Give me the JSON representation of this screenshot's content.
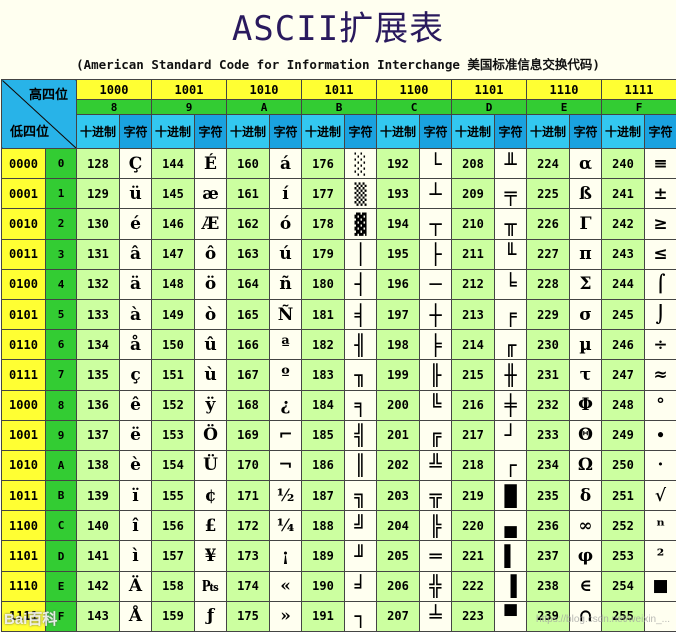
{
  "title": "ASCII扩展表",
  "subtitle": "(American Standard Code for Information Interchange  美国标准信息交换代码)",
  "corner": {
    "high_label": "高四位",
    "low_label": "低四位"
  },
  "sub_labels": {
    "decimal": "十进制",
    "char": "字符"
  },
  "columns": [
    {
      "bin": "1000",
      "hex": "8"
    },
    {
      "bin": "1001",
      "hex": "9"
    },
    {
      "bin": "1010",
      "hex": "A"
    },
    {
      "bin": "1011",
      "hex": "B"
    },
    {
      "bin": "1100",
      "hex": "C"
    },
    {
      "bin": "1101",
      "hex": "D"
    },
    {
      "bin": "1110",
      "hex": "E"
    },
    {
      "bin": "1111",
      "hex": "F"
    }
  ],
  "rows": [
    {
      "bin": "0000",
      "hex": "0",
      "cells": [
        [
          "128",
          "Ç"
        ],
        [
          "144",
          "É"
        ],
        [
          "160",
          "á"
        ],
        [
          "176",
          "░"
        ],
        [
          "192",
          "└"
        ],
        [
          "208",
          "╨"
        ],
        [
          "224",
          "α"
        ],
        [
          "240",
          "≡"
        ]
      ]
    },
    {
      "bin": "0001",
      "hex": "1",
      "cells": [
        [
          "129",
          "ü"
        ],
        [
          "145",
          "æ"
        ],
        [
          "161",
          "í"
        ],
        [
          "177",
          "▒"
        ],
        [
          "193",
          "┴"
        ],
        [
          "209",
          "╤"
        ],
        [
          "225",
          "ß"
        ],
        [
          "241",
          "±"
        ]
      ]
    },
    {
      "bin": "0010",
      "hex": "2",
      "cells": [
        [
          "130",
          "é"
        ],
        [
          "146",
          "Æ"
        ],
        [
          "162",
          "ó"
        ],
        [
          "178",
          "▓"
        ],
        [
          "194",
          "┬"
        ],
        [
          "210",
          "╥"
        ],
        [
          "226",
          "Γ"
        ],
        [
          "242",
          "≥"
        ]
      ]
    },
    {
      "bin": "0011",
      "hex": "3",
      "cells": [
        [
          "131",
          "â"
        ],
        [
          "147",
          "ô"
        ],
        [
          "163",
          "ú"
        ],
        [
          "179",
          "│"
        ],
        [
          "195",
          "├"
        ],
        [
          "211",
          "╙"
        ],
        [
          "227",
          "π"
        ],
        [
          "243",
          "≤"
        ]
      ]
    },
    {
      "bin": "0100",
      "hex": "4",
      "cells": [
        [
          "132",
          "ä"
        ],
        [
          "148",
          "ö"
        ],
        [
          "164",
          "ñ"
        ],
        [
          "180",
          "┤"
        ],
        [
          "196",
          "─"
        ],
        [
          "212",
          "╘"
        ],
        [
          "228",
          "Σ"
        ],
        [
          "244",
          "⌠"
        ]
      ]
    },
    {
      "bin": "0101",
      "hex": "5",
      "cells": [
        [
          "133",
          "à"
        ],
        [
          "149",
          "ò"
        ],
        [
          "165",
          "Ñ"
        ],
        [
          "181",
          "╡"
        ],
        [
          "197",
          "┼"
        ],
        [
          "213",
          "╒"
        ],
        [
          "229",
          "σ"
        ],
        [
          "245",
          "⌡"
        ]
      ]
    },
    {
      "bin": "0110",
      "hex": "6",
      "cells": [
        [
          "134",
          "å"
        ],
        [
          "150",
          "û"
        ],
        [
          "166",
          "ª"
        ],
        [
          "182",
          "╢"
        ],
        [
          "198",
          "╞"
        ],
        [
          "214",
          "╓"
        ],
        [
          "230",
          "µ"
        ],
        [
          "246",
          "÷"
        ]
      ]
    },
    {
      "bin": "0111",
      "hex": "7",
      "cells": [
        [
          "135",
          "ç"
        ],
        [
          "151",
          "ù"
        ],
        [
          "167",
          "º"
        ],
        [
          "183",
          "╖"
        ],
        [
          "199",
          "╟"
        ],
        [
          "215",
          "╫"
        ],
        [
          "231",
          "τ"
        ],
        [
          "247",
          "≈"
        ]
      ]
    },
    {
      "bin": "1000",
      "hex": "8",
      "cells": [
        [
          "136",
          "ê"
        ],
        [
          "152",
          "ÿ"
        ],
        [
          "168",
          "¿"
        ],
        [
          "184",
          "╕"
        ],
        [
          "200",
          "╚"
        ],
        [
          "216",
          "╪"
        ],
        [
          "232",
          "Φ"
        ],
        [
          "248",
          "°"
        ]
      ]
    },
    {
      "bin": "1001",
      "hex": "9",
      "cells": [
        [
          "137",
          "ë"
        ],
        [
          "153",
          "Ö"
        ],
        [
          "169",
          "⌐"
        ],
        [
          "185",
          "╣"
        ],
        [
          "201",
          "╔"
        ],
        [
          "217",
          "┘"
        ],
        [
          "233",
          "Θ"
        ],
        [
          "249",
          "∙"
        ]
      ]
    },
    {
      "bin": "1010",
      "hex": "A",
      "cells": [
        [
          "138",
          "è"
        ],
        [
          "154",
          "Ü"
        ],
        [
          "170",
          "¬"
        ],
        [
          "186",
          "║"
        ],
        [
          "202",
          "╩"
        ],
        [
          "218",
          "┌"
        ],
        [
          "234",
          "Ω"
        ],
        [
          "250",
          "·"
        ]
      ]
    },
    {
      "bin": "1011",
      "hex": "B",
      "cells": [
        [
          "139",
          "ï"
        ],
        [
          "155",
          "¢"
        ],
        [
          "171",
          "½"
        ],
        [
          "187",
          "╗"
        ],
        [
          "203",
          "╦"
        ],
        [
          "219",
          "█"
        ],
        [
          "235",
          "δ"
        ],
        [
          "251",
          "√"
        ]
      ]
    },
    {
      "bin": "1100",
      "hex": "C",
      "cells": [
        [
          "140",
          "î"
        ],
        [
          "156",
          "£"
        ],
        [
          "172",
          "¼"
        ],
        [
          "188",
          "╝"
        ],
        [
          "204",
          "╠"
        ],
        [
          "220",
          "▄"
        ],
        [
          "236",
          "∞"
        ],
        [
          "252",
          "ⁿ"
        ]
      ]
    },
    {
      "bin": "1101",
      "hex": "D",
      "cells": [
        [
          "141",
          "ì"
        ],
        [
          "157",
          "¥"
        ],
        [
          "173",
          "¡"
        ],
        [
          "189",
          "╜"
        ],
        [
          "205",
          "═"
        ],
        [
          "221",
          "▌"
        ],
        [
          "237",
          "φ"
        ],
        [
          "253",
          "²"
        ]
      ]
    },
    {
      "bin": "1110",
      "hex": "E",
      "cells": [
        [
          "142",
          "Ä"
        ],
        [
          "158",
          "₧"
        ],
        [
          "174",
          "«"
        ],
        [
          "190",
          "╛"
        ],
        [
          "206",
          "╬"
        ],
        [
          "222",
          "▐"
        ],
        [
          "238",
          "∈"
        ],
        [
          "254",
          "■"
        ]
      ]
    },
    {
      "bin": "1111",
      "hex": "F",
      "cells": [
        [
          "143",
          "Å"
        ],
        [
          "159",
          "ƒ"
        ],
        [
          "175",
          "»"
        ],
        [
          "191",
          "┐"
        ],
        [
          "207",
          "╧"
        ],
        [
          "223",
          "▀"
        ],
        [
          "239",
          "∩"
        ],
        [
          "255",
          ""
        ]
      ]
    }
  ],
  "watermark": {
    "left": "Bai百科",
    "right": "https://blog.csdn.net/weixin_..."
  }
}
